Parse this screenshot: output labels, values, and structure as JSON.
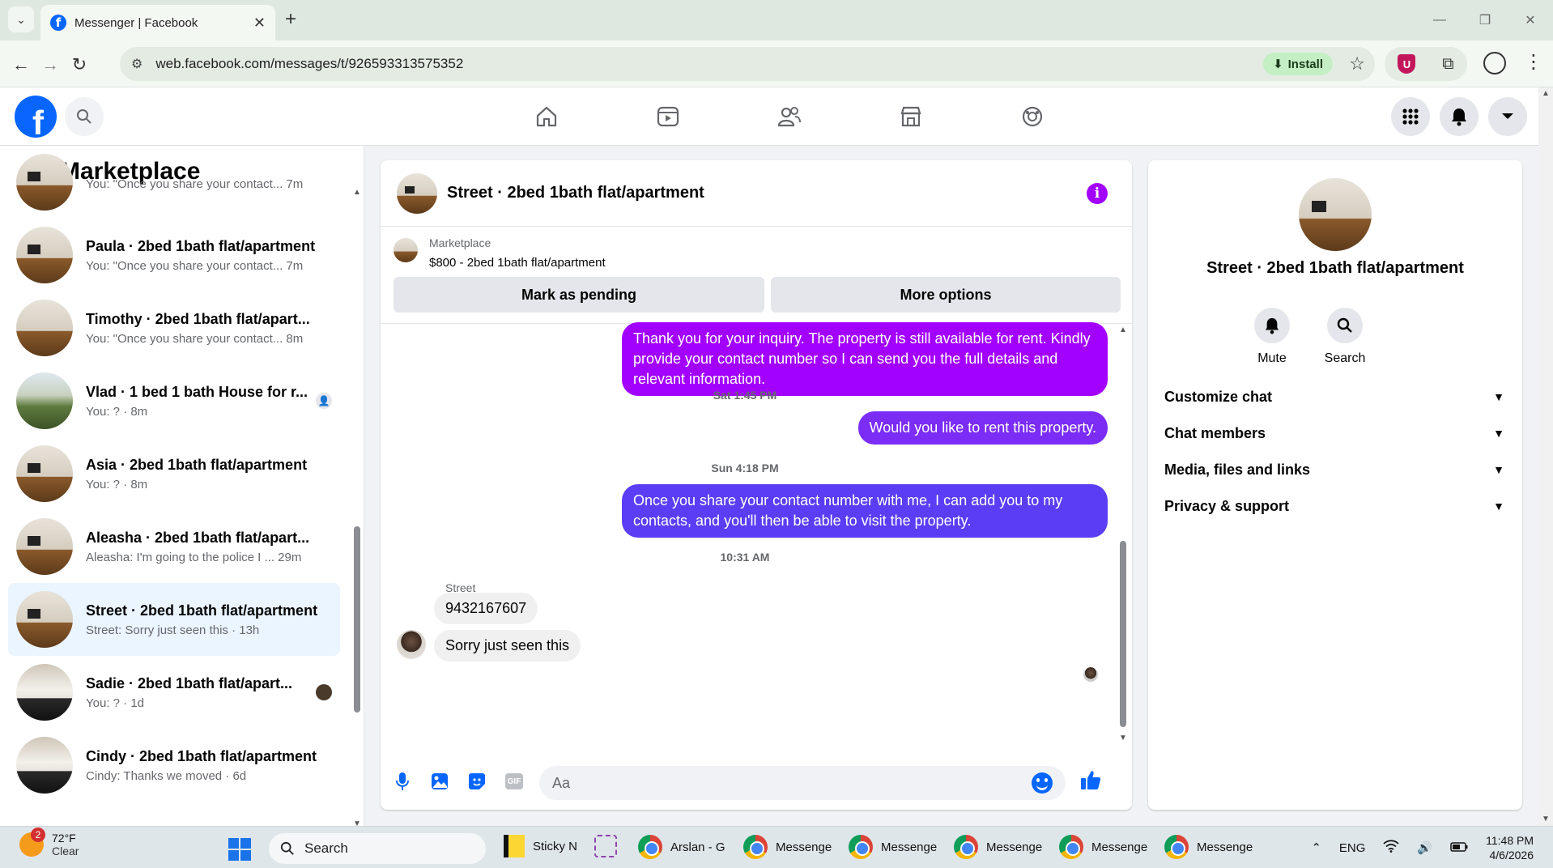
{
  "browser": {
    "tab_title": "Messenger | Facebook",
    "url": "web.facebook.com/messages/t/926593313575352",
    "install_label": "Install",
    "new_tab": "+",
    "close_tab": "✕"
  },
  "left_panel": {
    "title": "Marketplace",
    "conversations": [
      {
        "name": "",
        "preview": "You: \"Once you share your contact...  7m",
        "badge": ""
      },
      {
        "name": "Paula · 2bed 1bath flat/apartment",
        "preview": "You: \"Once you share your contact...  7m",
        "badge": ""
      },
      {
        "name": "Timothy · 2bed 1bath flat/apart...",
        "preview": "You: \"Once you share your contact...  8m",
        "badge": ""
      },
      {
        "name": "Vlad · 1 bed 1 bath House for r...",
        "preview": "You: ? · 8m",
        "badge": "person"
      },
      {
        "name": "Asia · 2bed 1bath flat/apartment",
        "preview": "You: ? · 8m",
        "badge": ""
      },
      {
        "name": "Aleasha · 2bed 1bath flat/apart...",
        "preview": "Aleasha: I'm going to the police I ...  29m",
        "badge": ""
      },
      {
        "name": "Street · 2bed 1bath flat/apartment",
        "preview": "Street: Sorry just seen this · 13h",
        "badge": ""
      },
      {
        "name": "Sadie · 2bed 1bath flat/apart...",
        "preview": "You: ? · 1d",
        "badge": "photo"
      },
      {
        "name": "Cindy · 2bed 1bath flat/apartment",
        "preview": "Cindy: Thanks we moved · 6d",
        "badge": ""
      }
    ]
  },
  "chat": {
    "title": "Street · 2bed 1bath flat/apartment",
    "marketplace_label": "Marketplace",
    "listing": "$800 - 2bed 1bath flat/apartment",
    "mark_pending": "Mark as pending",
    "more_options": "More options",
    "messages": {
      "m1": "Thank you for your inquiry. The property is still available for rent. Kindly provide your contact number so I can send you the full details and relevant information.",
      "ts1": "Sat 1:45 PM",
      "m2": "Would you like to rent this property.",
      "ts2": "Sun 4:18 PM",
      "m3": "Once you share your contact number with me, I can add you to my contacts, and you'll then be able to visit the property.",
      "ts3": "10:31 AM",
      "sender": "Street",
      "in1": "9432167607",
      "in2": "Sorry just seen this"
    },
    "input_placeholder": "Aa",
    "gif_label": "GIF"
  },
  "right_panel": {
    "name": "Street · 2bed 1bath flat/apartment",
    "mute_label": "Mute",
    "search_label": "Search",
    "sections": [
      "Customize chat",
      "Chat members",
      "Media, files and links",
      "Privacy & support"
    ]
  },
  "taskbar": {
    "temp": "72°F",
    "condition": "Clear",
    "weather_badge": "2",
    "search": "Search",
    "items": [
      "Sticky N",
      "Arslan - G",
      "Messenge",
      "Messenge",
      "Messenge",
      "Messenge",
      "Messenge"
    ],
    "lang": "ENG",
    "time": "11:48 PM",
    "date": "4/6/2026"
  },
  "colors": {
    "fb_blue": "#0866ff",
    "bubble_purple": "#a200ff",
    "bubble_mid": "#7b2cf5",
    "bubble_blue": "#5b3df5",
    "info_purple": "#a200ff"
  }
}
